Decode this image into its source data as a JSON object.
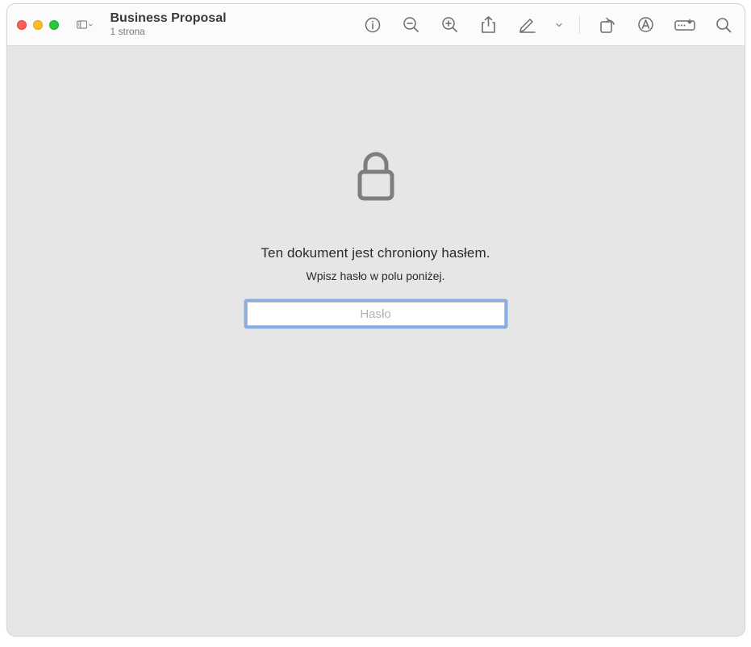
{
  "window": {
    "title": "Business Proposal",
    "subtitle": "1 strona"
  },
  "toolbar": {
    "sidebar_toggle": "sidebar-toggle",
    "info": "info",
    "zoom_out": "zoom-out",
    "zoom_in": "zoom-in",
    "share": "share",
    "highlight": "highlight",
    "rotate": "rotate",
    "markup": "markup",
    "form": "form",
    "search": "search"
  },
  "password_prompt": {
    "heading": "Ten dokument jest chroniony hasłem.",
    "subheading": "Wpisz hasło w polu poniżej.",
    "placeholder": "Hasło",
    "value": ""
  }
}
